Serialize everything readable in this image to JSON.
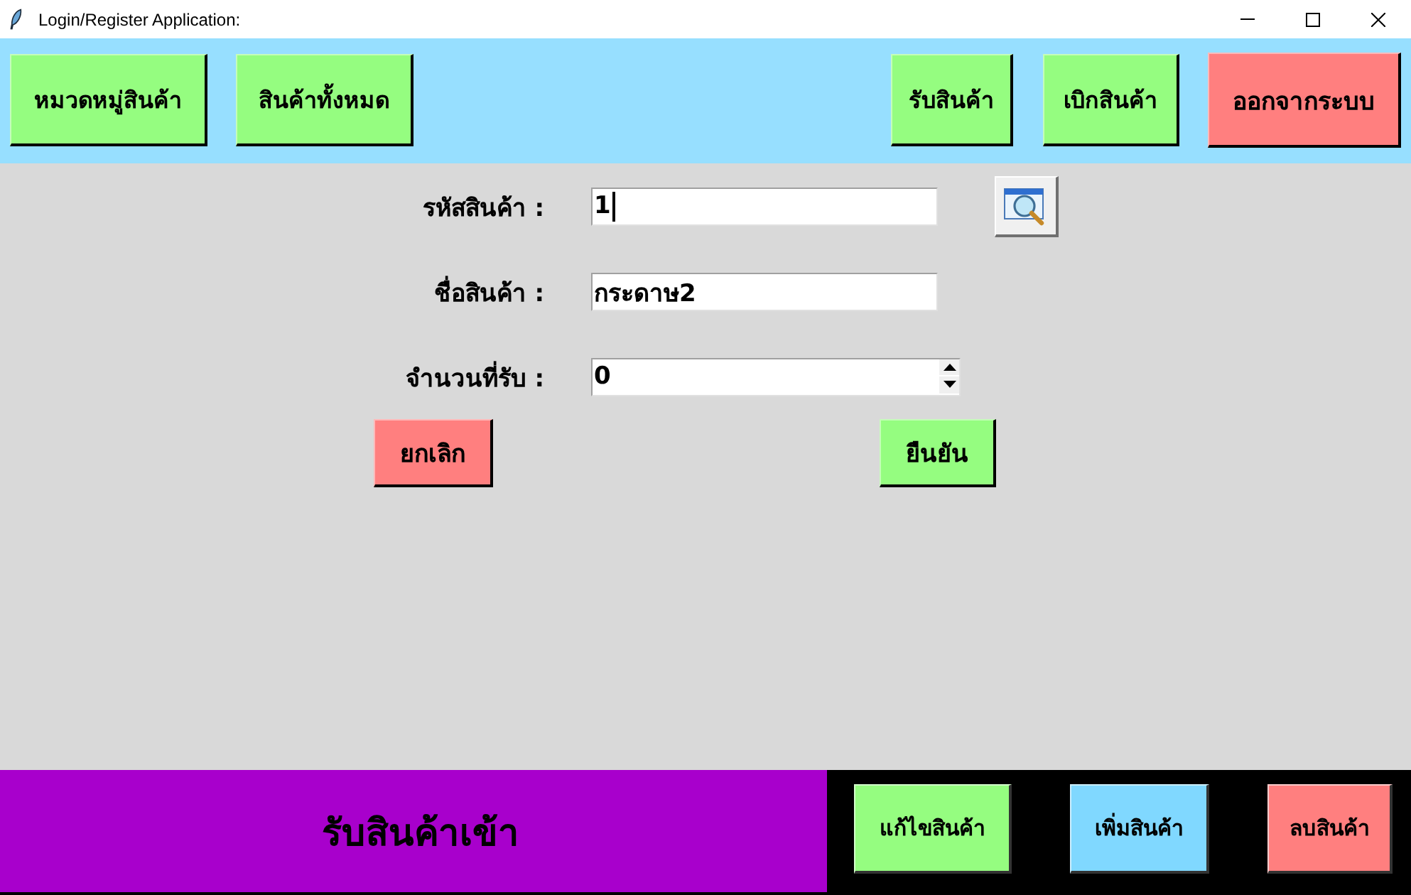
{
  "window": {
    "title": "Login/Register Application:"
  },
  "top_bar": {
    "left_buttons": [
      {
        "label": "หมวดหมู่สินค้า",
        "color": "#95fd80"
      },
      {
        "label": "สินค้าทั้งหมด",
        "color": "#95fd80"
      }
    ],
    "right_buttons": [
      {
        "label": "รับสินค้า",
        "color": "#95fd80"
      },
      {
        "label": "เบิกสินค้า",
        "color": "#95fd80"
      },
      {
        "label": "ออกจากระบบ",
        "color": "#ff7f7f"
      }
    ]
  },
  "form": {
    "fields": [
      {
        "label": "รหัสสินค้า :",
        "value": "1",
        "kind": "text",
        "focused": true
      },
      {
        "label": "ชื่อสินค้า :",
        "value": "กระดาษ2",
        "kind": "text",
        "focused": false
      },
      {
        "label": "จำนวนที่รับ :",
        "value": "0",
        "kind": "spinbox",
        "focused": false
      }
    ],
    "actions": [
      {
        "label": "ยกเลิก",
        "color": "#ff7f7f"
      },
      {
        "label": "ยืนยัน",
        "color": "#95fd80"
      }
    ]
  },
  "footer": {
    "title": "รับสินค้าเข้า",
    "buttons": [
      {
        "label": "แก้ไขสินค้า",
        "color": "#95fd80"
      },
      {
        "label": "เพิ่มสินค้า",
        "color": "#80d8ff"
      },
      {
        "label": "ลบสินค้า",
        "color": "#ff7f7f"
      }
    ]
  }
}
